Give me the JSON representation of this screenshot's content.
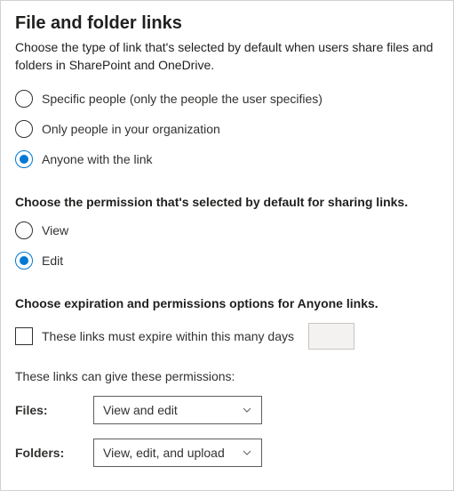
{
  "heading": "File and folder links",
  "description": "Choose the type of link that's selected by default when users share files and folders in SharePoint and OneDrive.",
  "link_type": {
    "options": [
      {
        "label": "Specific people (only the people the user specifies)",
        "selected": false
      },
      {
        "label": "Only people in your organization",
        "selected": false
      },
      {
        "label": "Anyone with the link",
        "selected": true
      }
    ]
  },
  "permission_heading": "Choose the permission that's selected by default for sharing links.",
  "permission": {
    "options": [
      {
        "label": "View",
        "selected": false
      },
      {
        "label": "Edit",
        "selected": true
      }
    ]
  },
  "expiration_heading": "Choose expiration and permissions options for Anyone links.",
  "expire_label": "These links must expire within this many days",
  "expire_days": "",
  "give_permissions_label": "These links can give these permissions:",
  "files_label": "Files:",
  "files_value": "View and edit",
  "folders_label": "Folders:",
  "folders_value": "View, edit, and upload"
}
